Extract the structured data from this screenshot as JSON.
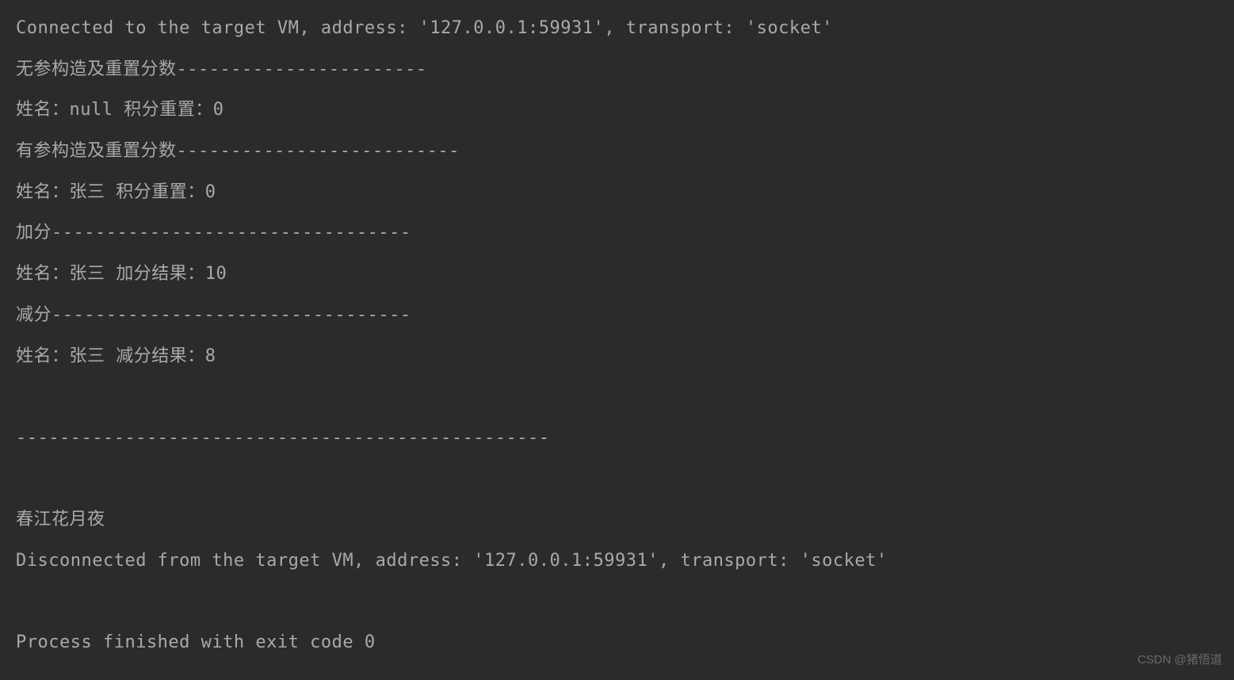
{
  "console": {
    "lines": [
      "Connected to the target VM, address: '127.0.0.1:59931', transport: 'socket'",
      "无参构造及重置分数-----------------------",
      "姓名：null 积分重置：0",
      "有参构造及重置分数--------------------------",
      "姓名：张三 积分重置：0",
      "加分---------------------------------",
      "姓名：张三 加分结果：10",
      "减分---------------------------------",
      "姓名：张三 减分结果：8",
      "",
      "-------------------------------------------------",
      "",
      "春江花月夜",
      "Disconnected from the target VM, address: '127.0.0.1:59931', transport: 'socket'",
      "",
      "Process finished with exit code 0"
    ]
  },
  "watermark": "CSDN @猪悟道"
}
